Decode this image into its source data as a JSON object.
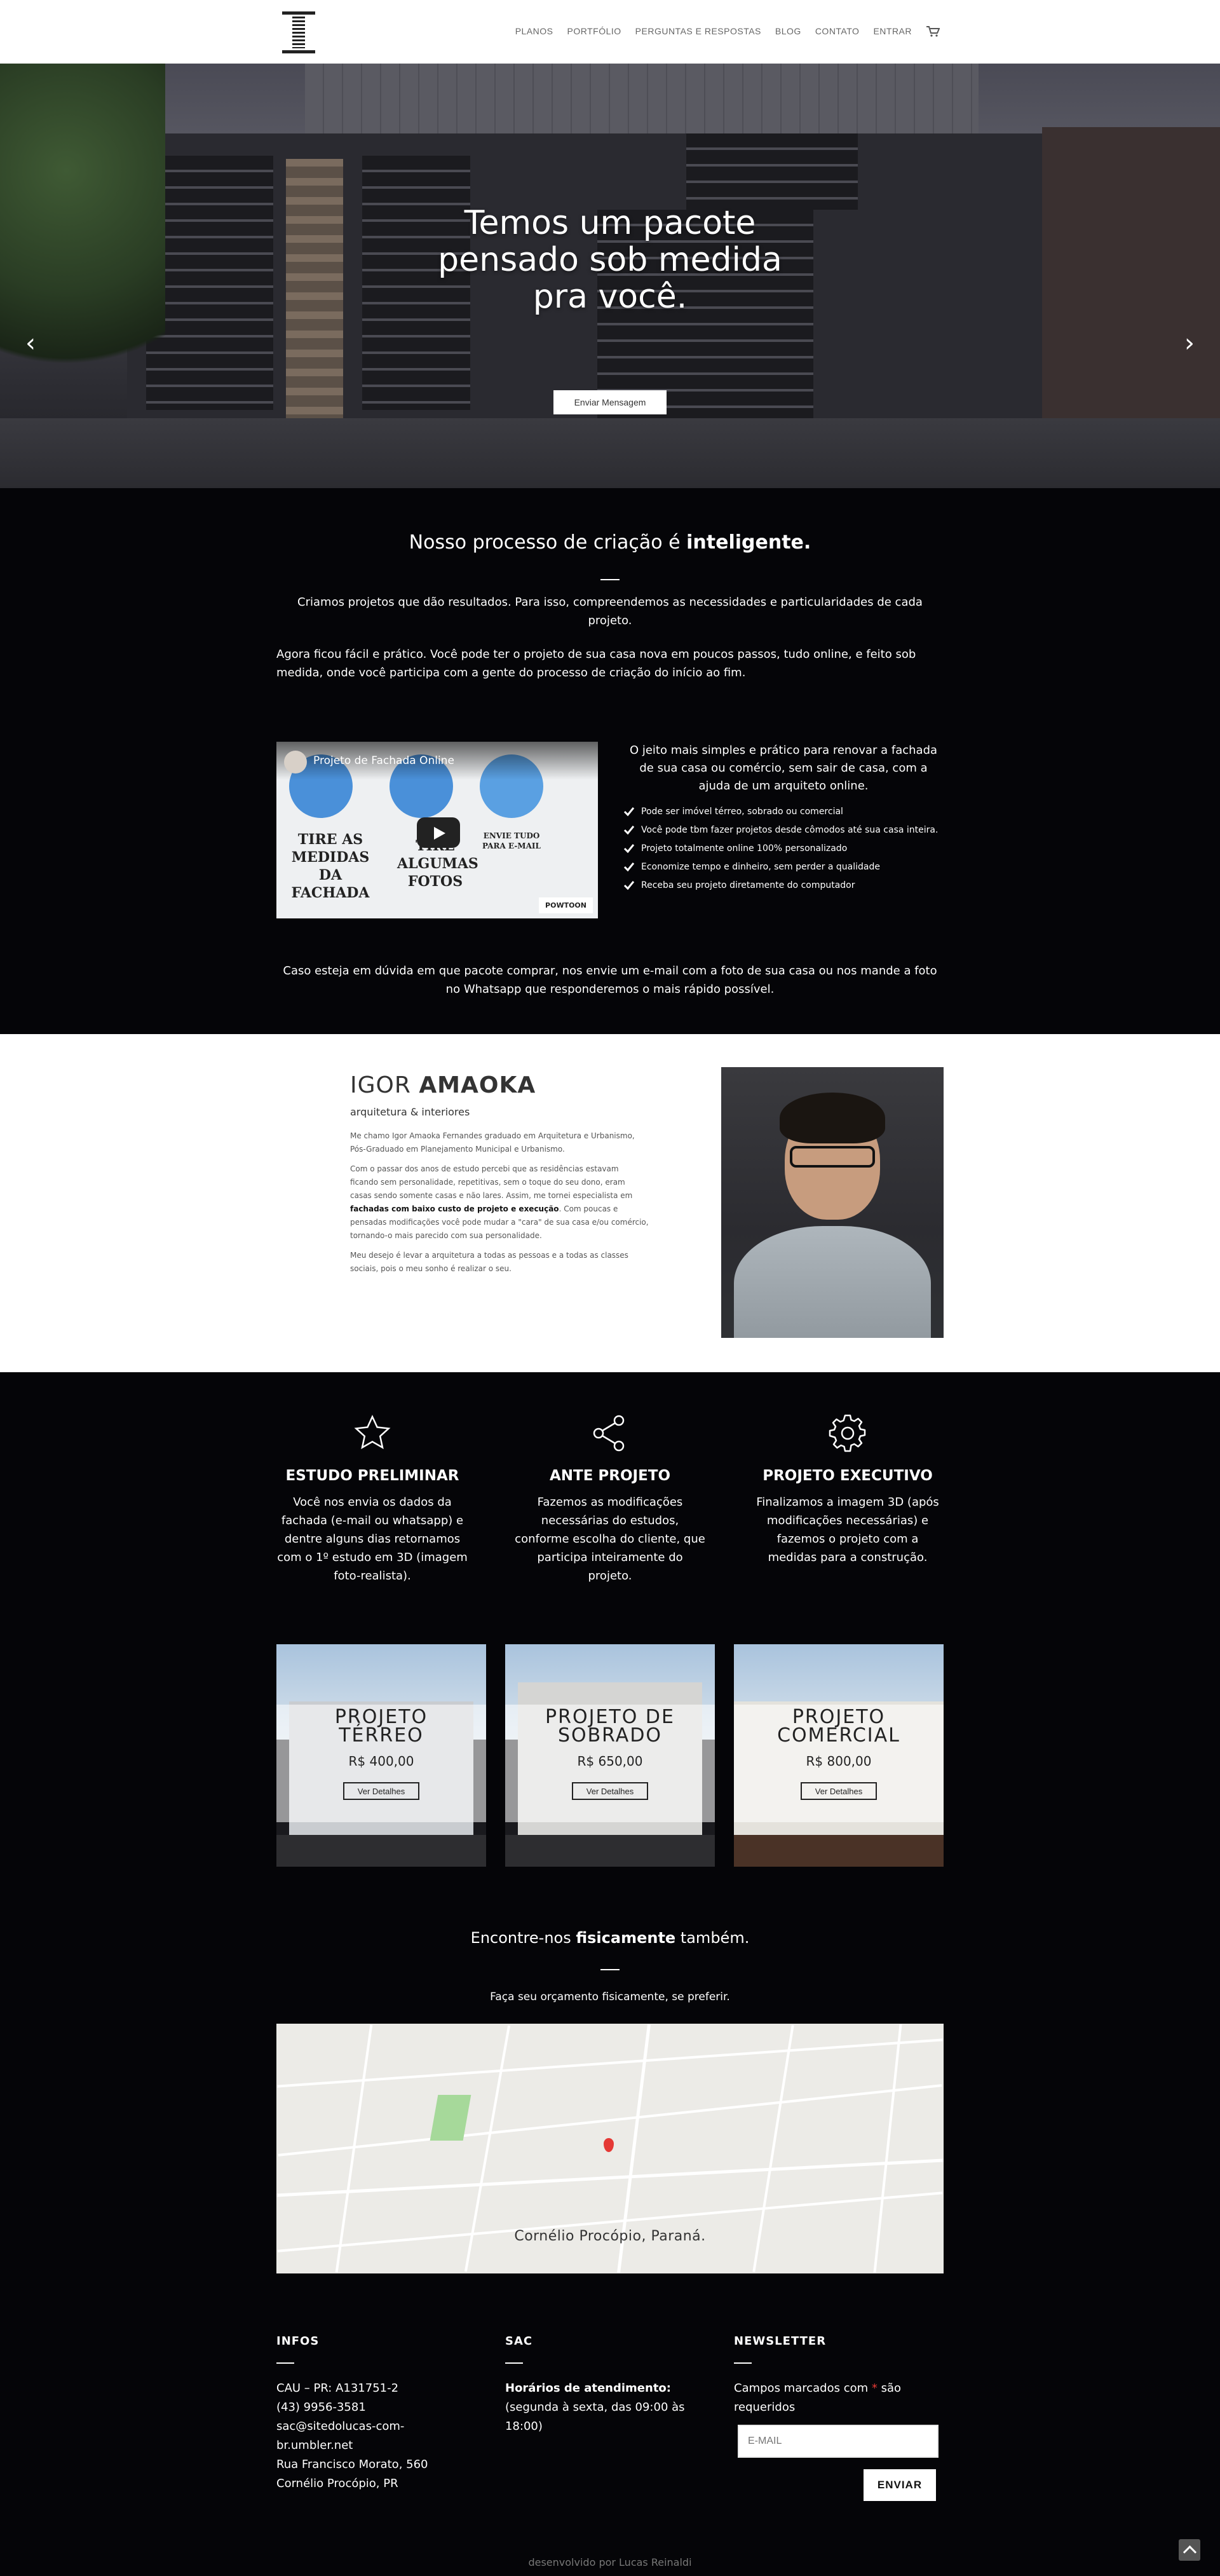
{
  "nav": {
    "items": [
      "PLANOS",
      "PORTFÓLIO",
      "PERGUNTAS E RESPOSTAS",
      "BLOG",
      "CONTATO",
      "ENTRAR"
    ],
    "cart_icon": "cart-icon"
  },
  "hero": {
    "title_line1": "Temos um pacote",
    "title_line2": "pensado sob medida",
    "title_line3": "pra você.",
    "button": "Enviar Mensagem",
    "prev_icon": "chevron-left-icon",
    "next_icon": "chevron-right-icon",
    "active_slide": 3,
    "slides": 3
  },
  "process": {
    "title_regular": "Nosso processo de criação é ",
    "title_bold": "inteligente.",
    "lead": "Criamos projetos que dão resultados. Para isso, compreendemos as necessidades e particularidades de cada projeto.",
    "body": "Agora ficou fácil e prático. Você pode ter o projeto de sua casa nova em poucos passos, tudo online, e feito sob medida, onde você participa com a gente do processo de criação do início ao fim.",
    "video": {
      "title": "Projeto de Fachada Online",
      "caption1": "TIRE AS MEDIDAS DA FACHADA",
      "caption2": "TIRE ALGUMAS FOTOS",
      "caption3": "ENVIE TUDO PARA E-MAIL",
      "brand": "POWTOON"
    },
    "intro": "O jeito mais simples e prático para renovar a fachada de sua casa ou comércio, sem sair de casa, com a ajuda de um arquiteto online.",
    "features": [
      "Pode ser imóvel térreo, sobrado ou comercial",
      "Você pode tbm fazer projetos desde cômodos até sua casa inteira.",
      "Projeto totalmente online 100% personalizado",
      "Economize tempo e dinheiro, sem perder a qualidade",
      "Receba seu projeto diretamente do computador"
    ],
    "cta": "Caso esteja em dúvida em que pacote comprar, nos envie um e-mail com a foto de sua casa ou nos mande a foto no Whatsapp que responderemos o mais rápido possível."
  },
  "about": {
    "first_name": "IGOR ",
    "last_name": "AMAOKA",
    "subtitle": "arquitetura & interiores",
    "p1": "Me chamo Igor Amaoka Fernandes graduado em Arquitetura e Urbanismo, Pós-Graduado em Planejamento Municipal e Urbanismo.",
    "p2_a": "Com o passar dos anos de estudo percebi que as residências estavam ficando sem personalidade, repetitivas, sem o toque do seu dono, eram casas sendo somente casas e não lares. Assim, me tornei especialista em ",
    "p2_bold": "fachadas com baixo custo de projeto e execução",
    "p2_b": ". Com poucas e pensadas modificações você pode mudar a \"cara\" de sua casa e/ou comércio, tornando-o mais parecido com sua personalidade.",
    "p3": "Meu desejo é levar a arquitetura a todas as pessoas e a todas as classes sociais, pois o meu sonho é realizar o seu."
  },
  "steps": [
    {
      "icon": "star-icon",
      "title": "ESTUDO PRELIMINAR",
      "text": "Você nos envia os dados da fachada (e-mail ou whatsapp) e dentre alguns dias retornamos com o 1º estudo em 3D (imagem foto-realista)."
    },
    {
      "icon": "share-icon",
      "title": "ANTE PROJETO",
      "text": "Fazemos as modificações necessárias do estudos, conforme escolha do cliente, que participa inteiramente do projeto."
    },
    {
      "icon": "gear-icon",
      "title": "PROJETO EXECUTIVO",
      "text": "Finalizamos a imagem 3D (após modificações necessárias) e fazemos o projeto com a medidas para a construção."
    }
  ],
  "plans": [
    {
      "line1": "PROJETO",
      "line2": "TÉRREO",
      "price": "R$ 400,00",
      "button": "Ver Detalhes"
    },
    {
      "line1": "PROJETO DE",
      "line2": "SOBRADO",
      "price": "R$ 650,00",
      "button": "Ver Detalhes"
    },
    {
      "line1": "PROJETO",
      "line2": "COMERCIAL",
      "price": "R$ 800,00",
      "button": "Ver Detalhes"
    }
  ],
  "location": {
    "title_a": "Encontre-nos ",
    "title_bold": "fisicamente",
    "title_b": " também.",
    "text": "Faça seu orçamento fisicamente, se preferir.",
    "map_label": "Cornélio Procópio, Paraná."
  },
  "footer": {
    "infos_title": "INFOS",
    "infos": [
      "CAU – PR: A131751-2",
      "(43) 9956-3581",
      "sac@sitedolucas-com-",
      "br.umbler.net",
      "Rua Francisco Morato, 560",
      "Cornélio Procópio, PR"
    ],
    "sac_title": "SAC",
    "sac_hours_label": "Horários de atendimento:",
    "sac_hours": "(segunda à sexta, das 09:00 às 18:00)",
    "newsletter_title": "NEWSLETTER",
    "newsletter_note_a": "Campos marcados com ",
    "newsletter_req": "*",
    "newsletter_note_b": " são requeridos",
    "email_placeholder": "E-MAIL",
    "submit": "ENVIAR",
    "credit": "desenvolvido por Lucas Reinaldi"
  }
}
